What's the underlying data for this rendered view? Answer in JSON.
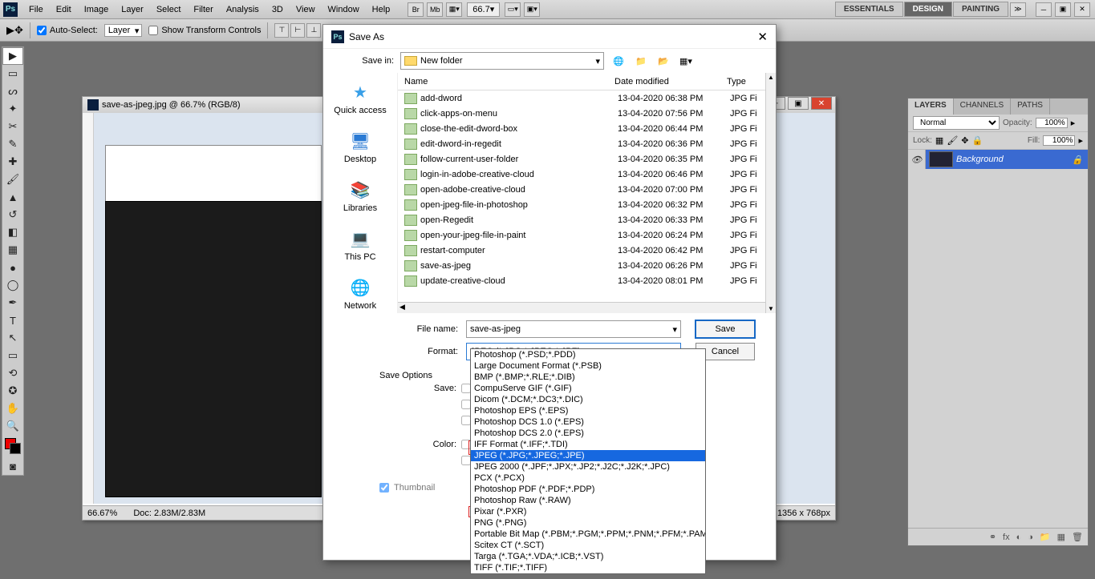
{
  "app": {
    "logo": "Ps"
  },
  "menubar": [
    "File",
    "Edit",
    "Image",
    "Layer",
    "Select",
    "Filter",
    "Analysis",
    "3D",
    "View",
    "Window",
    "Help"
  ],
  "zoom_menu": "66.7",
  "workspaces": {
    "essentials": "ESSENTIALS",
    "design": "DESIGN",
    "painting": "PAINTING"
  },
  "options": {
    "auto_select": "Auto-Select:",
    "auto_select_val": "Layer",
    "show_transform": "Show Transform Controls"
  },
  "canvas": {
    "title": "save-as-jpeg.jpg @ 66.7% (RGB/8)",
    "status_zoom": "66.67%",
    "status_doc": "Doc: 2.83M/2.83M",
    "status_size": "1356 x 768px"
  },
  "dialog": {
    "title": "Save As",
    "save_in_label": "Save in:",
    "save_in_value": "New folder",
    "places": {
      "quick": "Quick access",
      "desktop": "Desktop",
      "libraries": "Libraries",
      "thispc": "This PC",
      "network": "Network"
    },
    "cols": {
      "name": "Name",
      "date": "Date modified",
      "type": "Type"
    },
    "files": [
      {
        "n": "add-dword",
        "d": "13-04-2020 06:38 PM",
        "t": "JPG Fi"
      },
      {
        "n": "click-apps-on-menu",
        "d": "13-04-2020 07:56 PM",
        "t": "JPG Fi"
      },
      {
        "n": "close-the-edit-dword-box",
        "d": "13-04-2020 06:44 PM",
        "t": "JPG Fi"
      },
      {
        "n": "edit-dword-in-regedit",
        "d": "13-04-2020 06:36 PM",
        "t": "JPG Fi"
      },
      {
        "n": "follow-current-user-folder",
        "d": "13-04-2020 06:35 PM",
        "t": "JPG Fi"
      },
      {
        "n": "login-in-adobe-creative-cloud",
        "d": "13-04-2020 06:46 PM",
        "t": "JPG Fi"
      },
      {
        "n": "open-adobe-creative-cloud",
        "d": "13-04-2020 07:00 PM",
        "t": "JPG Fi"
      },
      {
        "n": "open-jpeg-file-in-photoshop",
        "d": "13-04-2020 06:32 PM",
        "t": "JPG Fi"
      },
      {
        "n": "open-Regedit",
        "d": "13-04-2020 06:33 PM",
        "t": "JPG Fi"
      },
      {
        "n": "open-your-jpeg-file-in-paint",
        "d": "13-04-2020 06:24 PM",
        "t": "JPG Fi"
      },
      {
        "n": "restart-computer",
        "d": "13-04-2020 06:42 PM",
        "t": "JPG Fi"
      },
      {
        "n": "save-as-jpeg",
        "d": "13-04-2020 06:26 PM",
        "t": "JPG Fi"
      },
      {
        "n": "update-creative-cloud",
        "d": "13-04-2020 08:01 PM",
        "t": "JPG Fi"
      }
    ],
    "file_name_label": "File name:",
    "file_name_value": "save-as-jpeg",
    "format_label": "Format:",
    "format_value": "JPEG (*.JPG;*.JPEG;*.JPE)",
    "save_btn": "Save",
    "cancel_btn": "Cancel",
    "save_options": "Save Options",
    "save_lbl": "Save:",
    "color_lbl": "Color:",
    "thumbnail": "Thumbnail"
  },
  "formats": [
    "Photoshop (*.PSD;*.PDD)",
    "Large Document Format (*.PSB)",
    "BMP (*.BMP;*.RLE;*.DIB)",
    "CompuServe GIF (*.GIF)",
    "Dicom (*.DCM;*.DC3;*.DIC)",
    "Photoshop EPS (*.EPS)",
    "Photoshop DCS 1.0 (*.EPS)",
    "Photoshop DCS 2.0 (*.EPS)",
    "IFF Format (*.IFF;*.TDI)",
    "JPEG (*.JPG;*.JPEG;*.JPE)",
    "JPEG 2000 (*.JPF;*.JPX;*.JP2;*.J2C;*.J2K;*.JPC)",
    "PCX (*.PCX)",
    "Photoshop PDF (*.PDF;*.PDP)",
    "Photoshop Raw (*.RAW)",
    "Pixar (*.PXR)",
    "PNG (*.PNG)",
    "Portable Bit Map (*.PBM;*.PGM;*.PPM;*.PNM;*.PFM;*.PAM)",
    "Scitex CT (*.SCT)",
    "Targa (*.TGA;*.VDA;*.ICB;*.VST)",
    "TIFF (*.TIF;*.TIFF)"
  ],
  "layers": {
    "tabs": {
      "layers": "LAYERS",
      "channels": "CHANNELS",
      "paths": "PATHS"
    },
    "blend": "Normal",
    "opacity_label": "Opacity:",
    "opacity_value": "100%",
    "lock_label": "Lock:",
    "fill_label": "Fill:",
    "fill_value": "100%",
    "bg_layer": "Background"
  }
}
